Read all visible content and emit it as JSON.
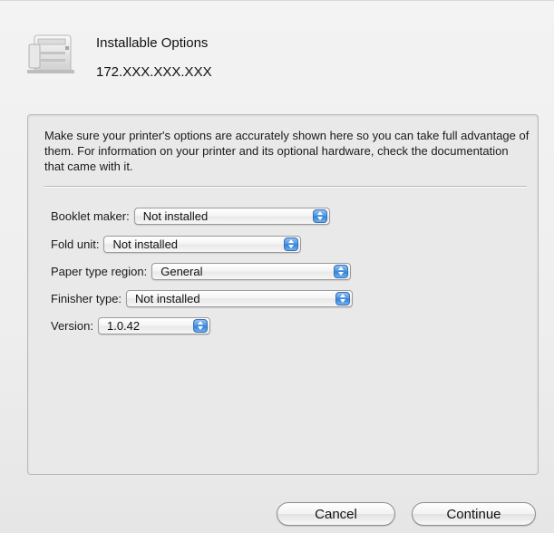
{
  "header": {
    "title": "Installable Options",
    "address": "172.XXX.XXX.XXX"
  },
  "description": "Make sure your printer's options are accurately shown here so you can take full advantage of them.  For information on your printer and its optional hardware, check the documentation that came with it.",
  "options": [
    {
      "label": "Booklet maker:",
      "value": "Not installed"
    },
    {
      "label": "Fold unit:",
      "value": "Not installed"
    },
    {
      "label": "Paper type region:",
      "value": "General"
    },
    {
      "label": "Finisher type:",
      "value": "Not installed"
    },
    {
      "label": "Version:",
      "value": "1.0.42"
    }
  ],
  "buttons": {
    "cancel": "Cancel",
    "continue": "Continue"
  },
  "colors": {
    "accent": "#4a93e3",
    "sheet_background": "#eeeeee",
    "panel_background": "#e9e9e9"
  },
  "icons": {
    "printer": "printer-icon",
    "popup_arrows": "up-down-arrows-icon"
  }
}
